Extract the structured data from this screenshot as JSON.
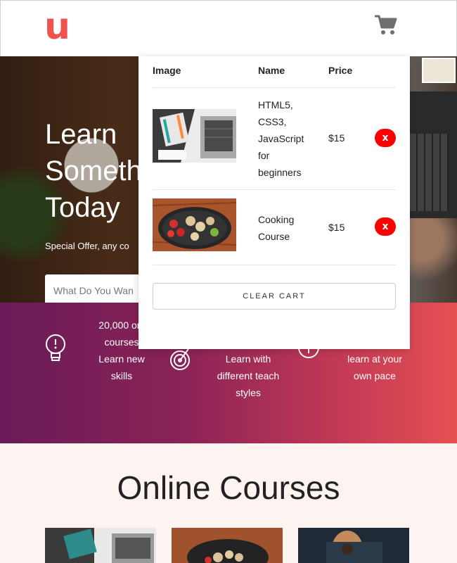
{
  "header": {
    "logo_text": "u",
    "logo_color": "#ef5350",
    "cart_icon": "shopping-cart-icon"
  },
  "hero": {
    "title": "Learn\nSometh\nToday",
    "offer": "Special Offer, any co",
    "search_placeholder": "What Do You Wan"
  },
  "features": [
    {
      "icon": "lightbulb-icon",
      "text_top": "20,000 onl\ncourses",
      "text": "Learn new\nskills"
    },
    {
      "icon": "target-icon",
      "text": "Learn with\ndifferent teach\nstyles"
    },
    {
      "icon": "clock-icon",
      "text": "learn at your\nown pace"
    }
  ],
  "cart": {
    "headers": {
      "image": "Image",
      "name": "Name",
      "price": "Price"
    },
    "items": [
      {
        "image": "laptop-notebook-image",
        "name": "HTML5,\nCSS3,\nJavaScript\nfor\nbeginners",
        "price": "$15",
        "remove": "x"
      },
      {
        "image": "cooking-pan-image",
        "name": "Cooking\nCourse",
        "price": "$15",
        "remove": "x"
      }
    ],
    "clear_label": "CLEAR CART"
  },
  "courses": {
    "title": "Online Courses",
    "thumbnails": [
      "laptop-notebook-image",
      "cooking-pan-image",
      "guitar-image"
    ]
  },
  "colors": {
    "accent": "#ef5350",
    "band_start": "#6a1b58",
    "band_end": "#e55052",
    "remove": "#ff0000",
    "courses_bg": "#fdf3f1"
  }
}
